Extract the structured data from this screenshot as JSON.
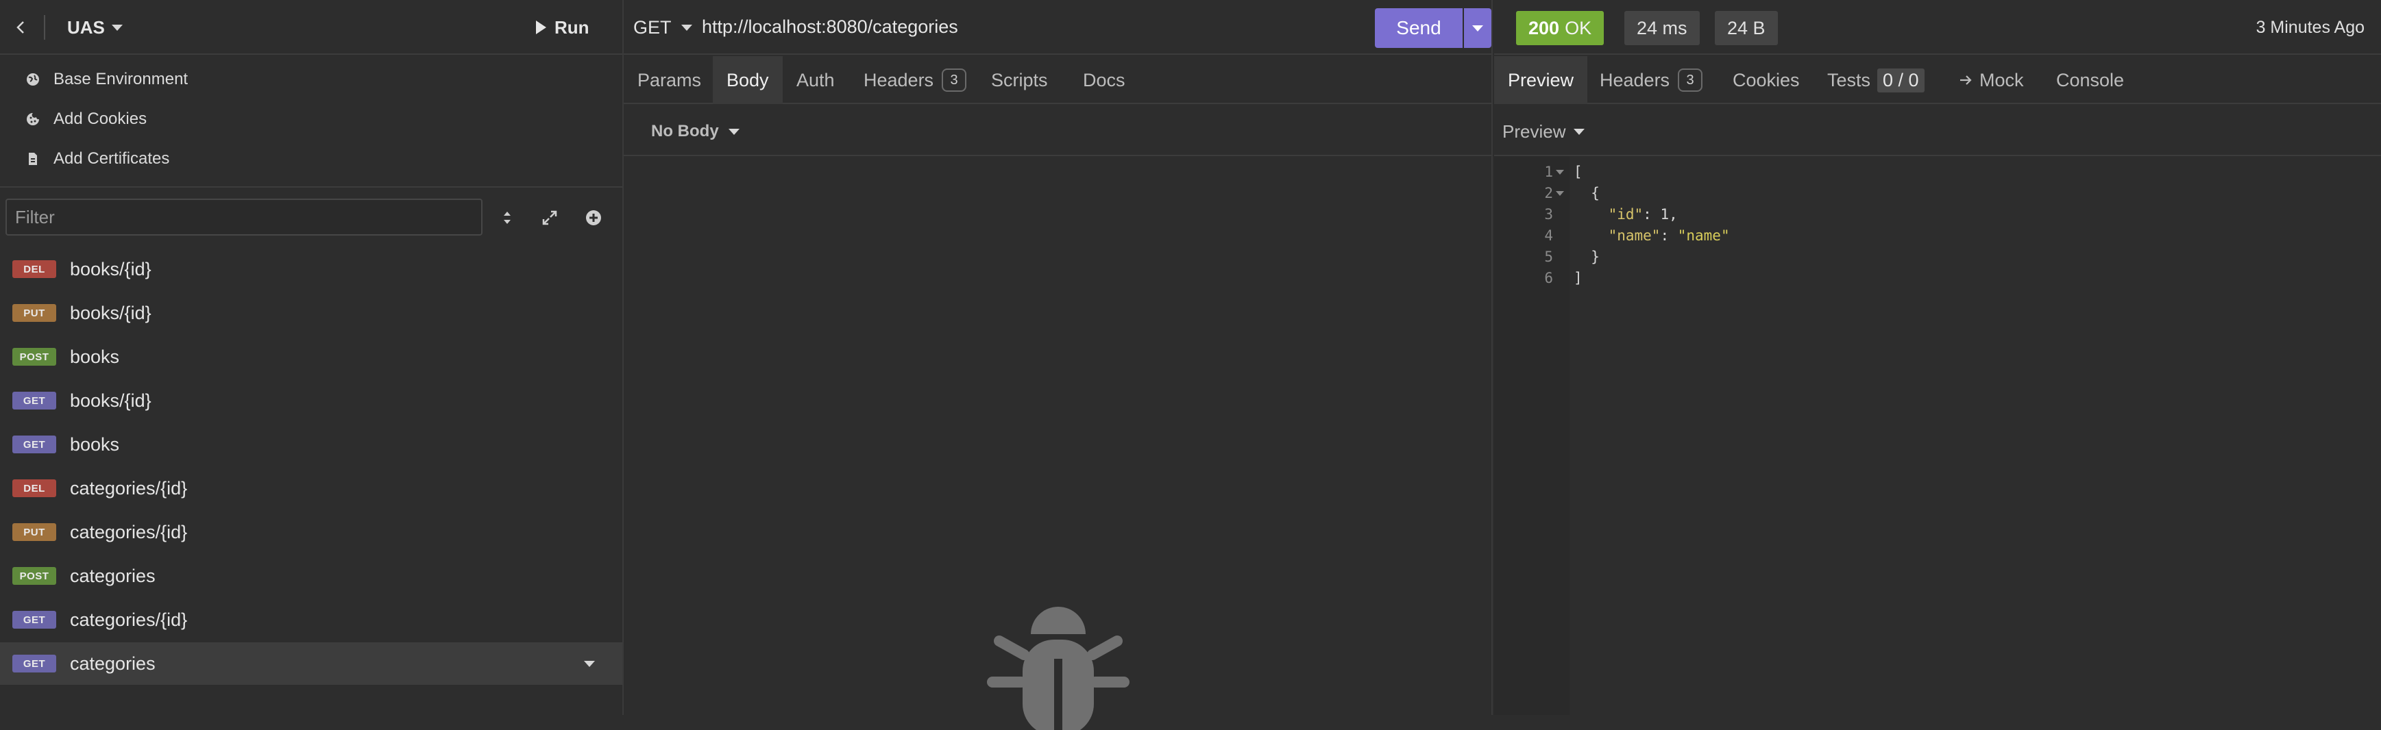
{
  "sidebar": {
    "project_name": "UAS",
    "run_label": "Run",
    "env_items": [
      {
        "label": "Base Environment",
        "icon": "globe-icon"
      },
      {
        "label": "Add Cookies",
        "icon": "cookie-icon"
      },
      {
        "label": "Add Certificates",
        "icon": "certificate-icon"
      }
    ],
    "filter_placeholder": "Filter",
    "requests": [
      {
        "method": "DEL",
        "label": "books/{id}"
      },
      {
        "method": "PUT",
        "label": "books/{id}"
      },
      {
        "method": "POST",
        "label": "books"
      },
      {
        "method": "GET",
        "label": "books/{id}"
      },
      {
        "method": "GET",
        "label": "books"
      },
      {
        "method": "DEL",
        "label": "categories/{id}"
      },
      {
        "method": "PUT",
        "label": "categories/{id}"
      },
      {
        "method": "POST",
        "label": "categories"
      },
      {
        "method": "GET",
        "label": "categories/{id}"
      },
      {
        "method": "GET",
        "label": "categories",
        "active": true
      }
    ]
  },
  "request": {
    "method": "GET",
    "url": "http://localhost:8080/categories",
    "send_label": "Send",
    "tabs": [
      {
        "label": "Params"
      },
      {
        "label": "Body",
        "active": true
      },
      {
        "label": "Auth"
      },
      {
        "label": "Headers",
        "count": "3"
      },
      {
        "label": "Scripts"
      },
      {
        "label": "Docs"
      }
    ],
    "body_type": "No Body"
  },
  "response": {
    "status_code": "200",
    "status_text": "OK",
    "time": "24 ms",
    "size": "24 B",
    "time_ago": "3 Minutes Ago",
    "tabs": [
      {
        "label": "Preview",
        "active": true
      },
      {
        "label": "Headers",
        "count": "3"
      },
      {
        "label": "Cookies"
      },
      {
        "label": "Tests",
        "count": "0 / 0"
      },
      {
        "label": "Mock"
      },
      {
        "label": "Console"
      }
    ],
    "preview_mode": "Preview",
    "lines": [
      {
        "n": "1",
        "text": "["
      },
      {
        "n": "2",
        "text": "  {"
      },
      {
        "n": "3",
        "key": "\"id\"",
        "value": "1,",
        "vtype": "num"
      },
      {
        "n": "4",
        "key": "\"name\"",
        "value": "\"name\"",
        "vtype": "str"
      },
      {
        "n": "5",
        "text": "  }"
      },
      {
        "n": "6",
        "text": "]"
      }
    ]
  },
  "colors": {
    "accent": "#7b6fd1",
    "status_ok": "#75ac36",
    "del": "#a9473e",
    "put": "#a0723d",
    "post": "#5f8a3c",
    "get": "#6a65a8"
  }
}
